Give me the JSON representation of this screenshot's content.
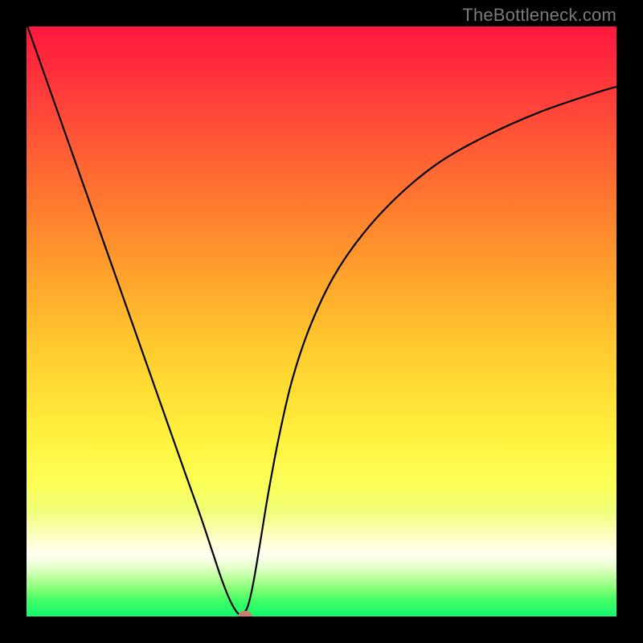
{
  "watermark": "TheBottleneck.com",
  "marker": {
    "x_pct": 0.37,
    "y_pct": 0.998
  },
  "chart_data": {
    "type": "line",
    "title": "",
    "xlabel": "",
    "ylabel": "",
    "xlim": [
      0,
      1
    ],
    "ylim": [
      0,
      1
    ],
    "grid": false,
    "series": [
      {
        "name": "bottleneck-curve",
        "x": [
          0.0,
          0.03,
          0.06,
          0.09,
          0.12,
          0.15,
          0.18,
          0.21,
          0.24,
          0.27,
          0.295,
          0.315,
          0.33,
          0.342,
          0.352,
          0.36,
          0.368,
          0.376,
          0.385,
          0.396,
          0.41,
          0.428,
          0.45,
          0.48,
          0.52,
          0.57,
          0.63,
          0.7,
          0.78,
          0.87,
          0.96,
          1.0
        ],
        "y": [
          1.005,
          0.92,
          0.835,
          0.75,
          0.665,
          0.58,
          0.495,
          0.41,
          0.325,
          0.24,
          0.17,
          0.11,
          0.065,
          0.034,
          0.014,
          0.004,
          0.005,
          0.02,
          0.06,
          0.125,
          0.21,
          0.305,
          0.4,
          0.49,
          0.575,
          0.648,
          0.713,
          0.77,
          0.815,
          0.855,
          0.886,
          0.898
        ]
      }
    ],
    "annotations": [
      {
        "type": "marker",
        "x": 0.37,
        "y": 0.002
      }
    ],
    "background": "rainbow-gradient-red-to-green"
  }
}
